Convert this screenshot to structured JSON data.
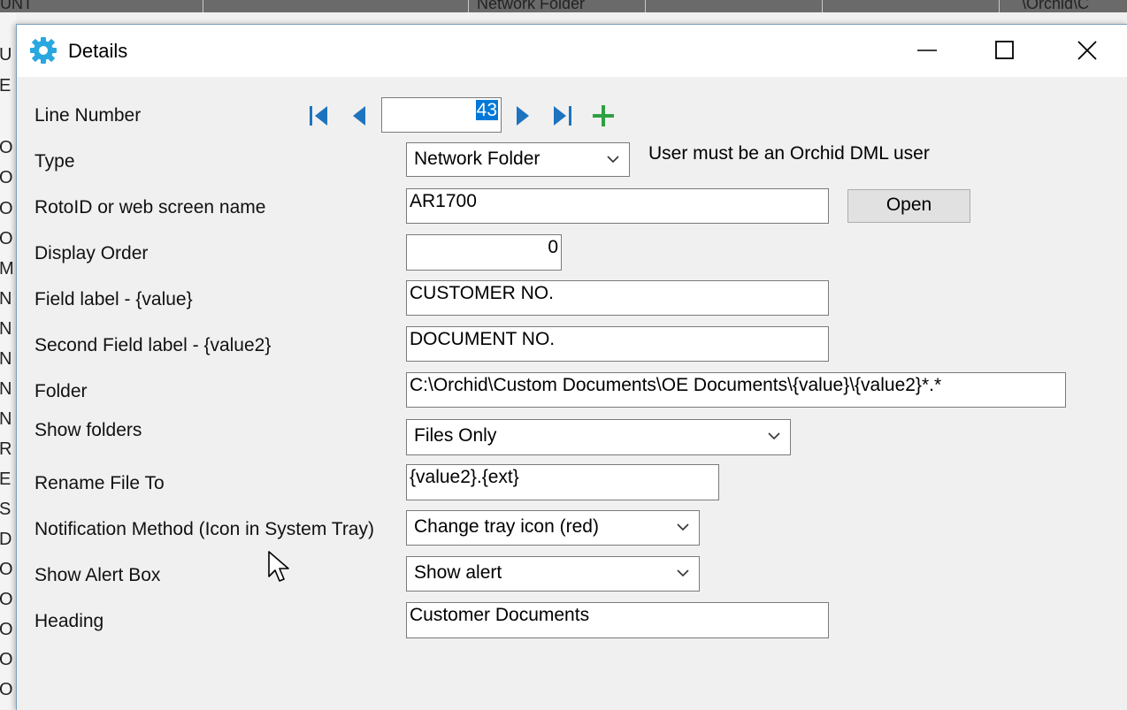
{
  "background": {
    "header_fragments": [
      "UNT",
      "Network Folder",
      "\\Orchid\\C"
    ],
    "left_fragments": [
      "U",
      "E",
      "O",
      "O",
      "O",
      "O",
      "M",
      "N",
      "N",
      "N",
      "N",
      "N",
      "R",
      "E",
      "S",
      "D",
      "O",
      "O",
      "O",
      "O",
      "O"
    ]
  },
  "window": {
    "title": "Details",
    "icon": "gear-icon",
    "controls": [
      "minimize-icon",
      "maximize-icon",
      "close-icon"
    ]
  },
  "form": {
    "line_number": {
      "label": "Line Number",
      "value": "43"
    },
    "type": {
      "label": "Type",
      "value": "Network Folder",
      "note": "User must be an Orchid DML user"
    },
    "rotoid": {
      "label": "RotoID or web screen name",
      "value": "AR1700",
      "open_button": "Open"
    },
    "display_order": {
      "label": "Display Order",
      "value": "0"
    },
    "field_label": {
      "label": "Field label - {value}",
      "value": "CUSTOMER NO."
    },
    "second_field_label": {
      "label": "Second Field label - {value2}",
      "value": "DOCUMENT NO."
    },
    "folder": {
      "label": "Folder",
      "value": "C:\\Orchid\\Custom Documents\\OE Documents\\{value}\\{value2}*.*"
    },
    "show_folders": {
      "label": "Show folders",
      "value": "Files Only"
    },
    "rename_file": {
      "label": "Rename File To",
      "value": "{value2}.{ext}"
    },
    "notification": {
      "label": "Notification Method (Icon in System Tray)",
      "value": "Change tray icon (red)"
    },
    "alert_box": {
      "label": "Show Alert Box",
      "value": "Show alert"
    },
    "heading": {
      "label": "Heading",
      "value": "Customer Documents"
    }
  },
  "colors": {
    "nav_icon": "#1e73be",
    "add_icon": "#2ea043",
    "selection": "#0078d7",
    "title_icon": "#29a8e0"
  }
}
